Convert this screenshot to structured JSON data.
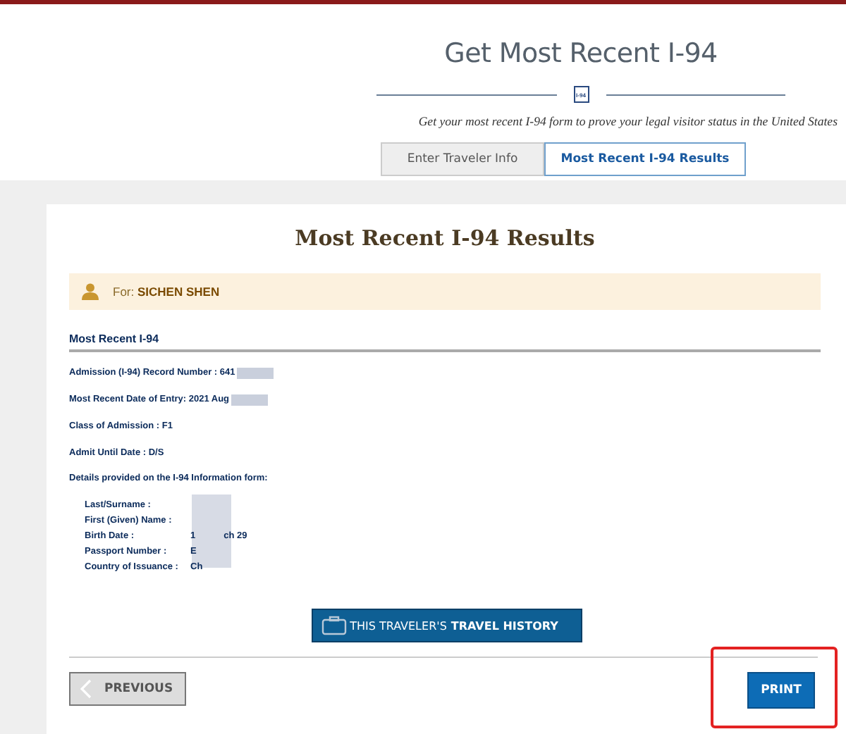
{
  "header": {
    "title": "Get Most Recent I-94",
    "icon_label": "I-94",
    "subtitle": "Get your most recent I-94 form to prove your legal visitor status in the United States"
  },
  "tabs": [
    {
      "label": "Enter Traveler Info",
      "selected": false
    },
    {
      "label": "Most Recent I-94 Results",
      "selected": true
    }
  ],
  "results": {
    "title": "Most Recent I-94 Results",
    "for_label": "For:",
    "for_name": "SICHEN SHEN",
    "section_title": "Most Recent I-94",
    "fields": [
      {
        "label": "Admission (I-94) Record Number :",
        "value": "641",
        "redacted": true
      },
      {
        "label": "Most Recent Date of Entry:",
        "value": "2021 Aug",
        "redacted": true
      },
      {
        "label": "Class of Admission :",
        "value": "F1",
        "redacted": false
      },
      {
        "label": "Admit Until Date :",
        "value": "D/S",
        "redacted": false
      }
    ],
    "details_title": "Details provided on the I-94 Information form:",
    "details": [
      {
        "label": "Last/Surname :"
      },
      {
        "label": "First (Given) Name :"
      },
      {
        "label": "Birth Date :",
        "value": "1",
        "value_end": "ch 29"
      },
      {
        "label": "Passport Number :",
        "value": "E"
      },
      {
        "label": "Country of Issuance :",
        "value": "Ch"
      }
    ],
    "history_button": {
      "label_start": "THIS TRAVELER'S",
      "label_bold": "TRAVEL HISTORY"
    }
  },
  "footer": {
    "previous": "PREVIOUS",
    "print": {
      "label": "PRINT",
      "highlighted": true
    }
  }
}
